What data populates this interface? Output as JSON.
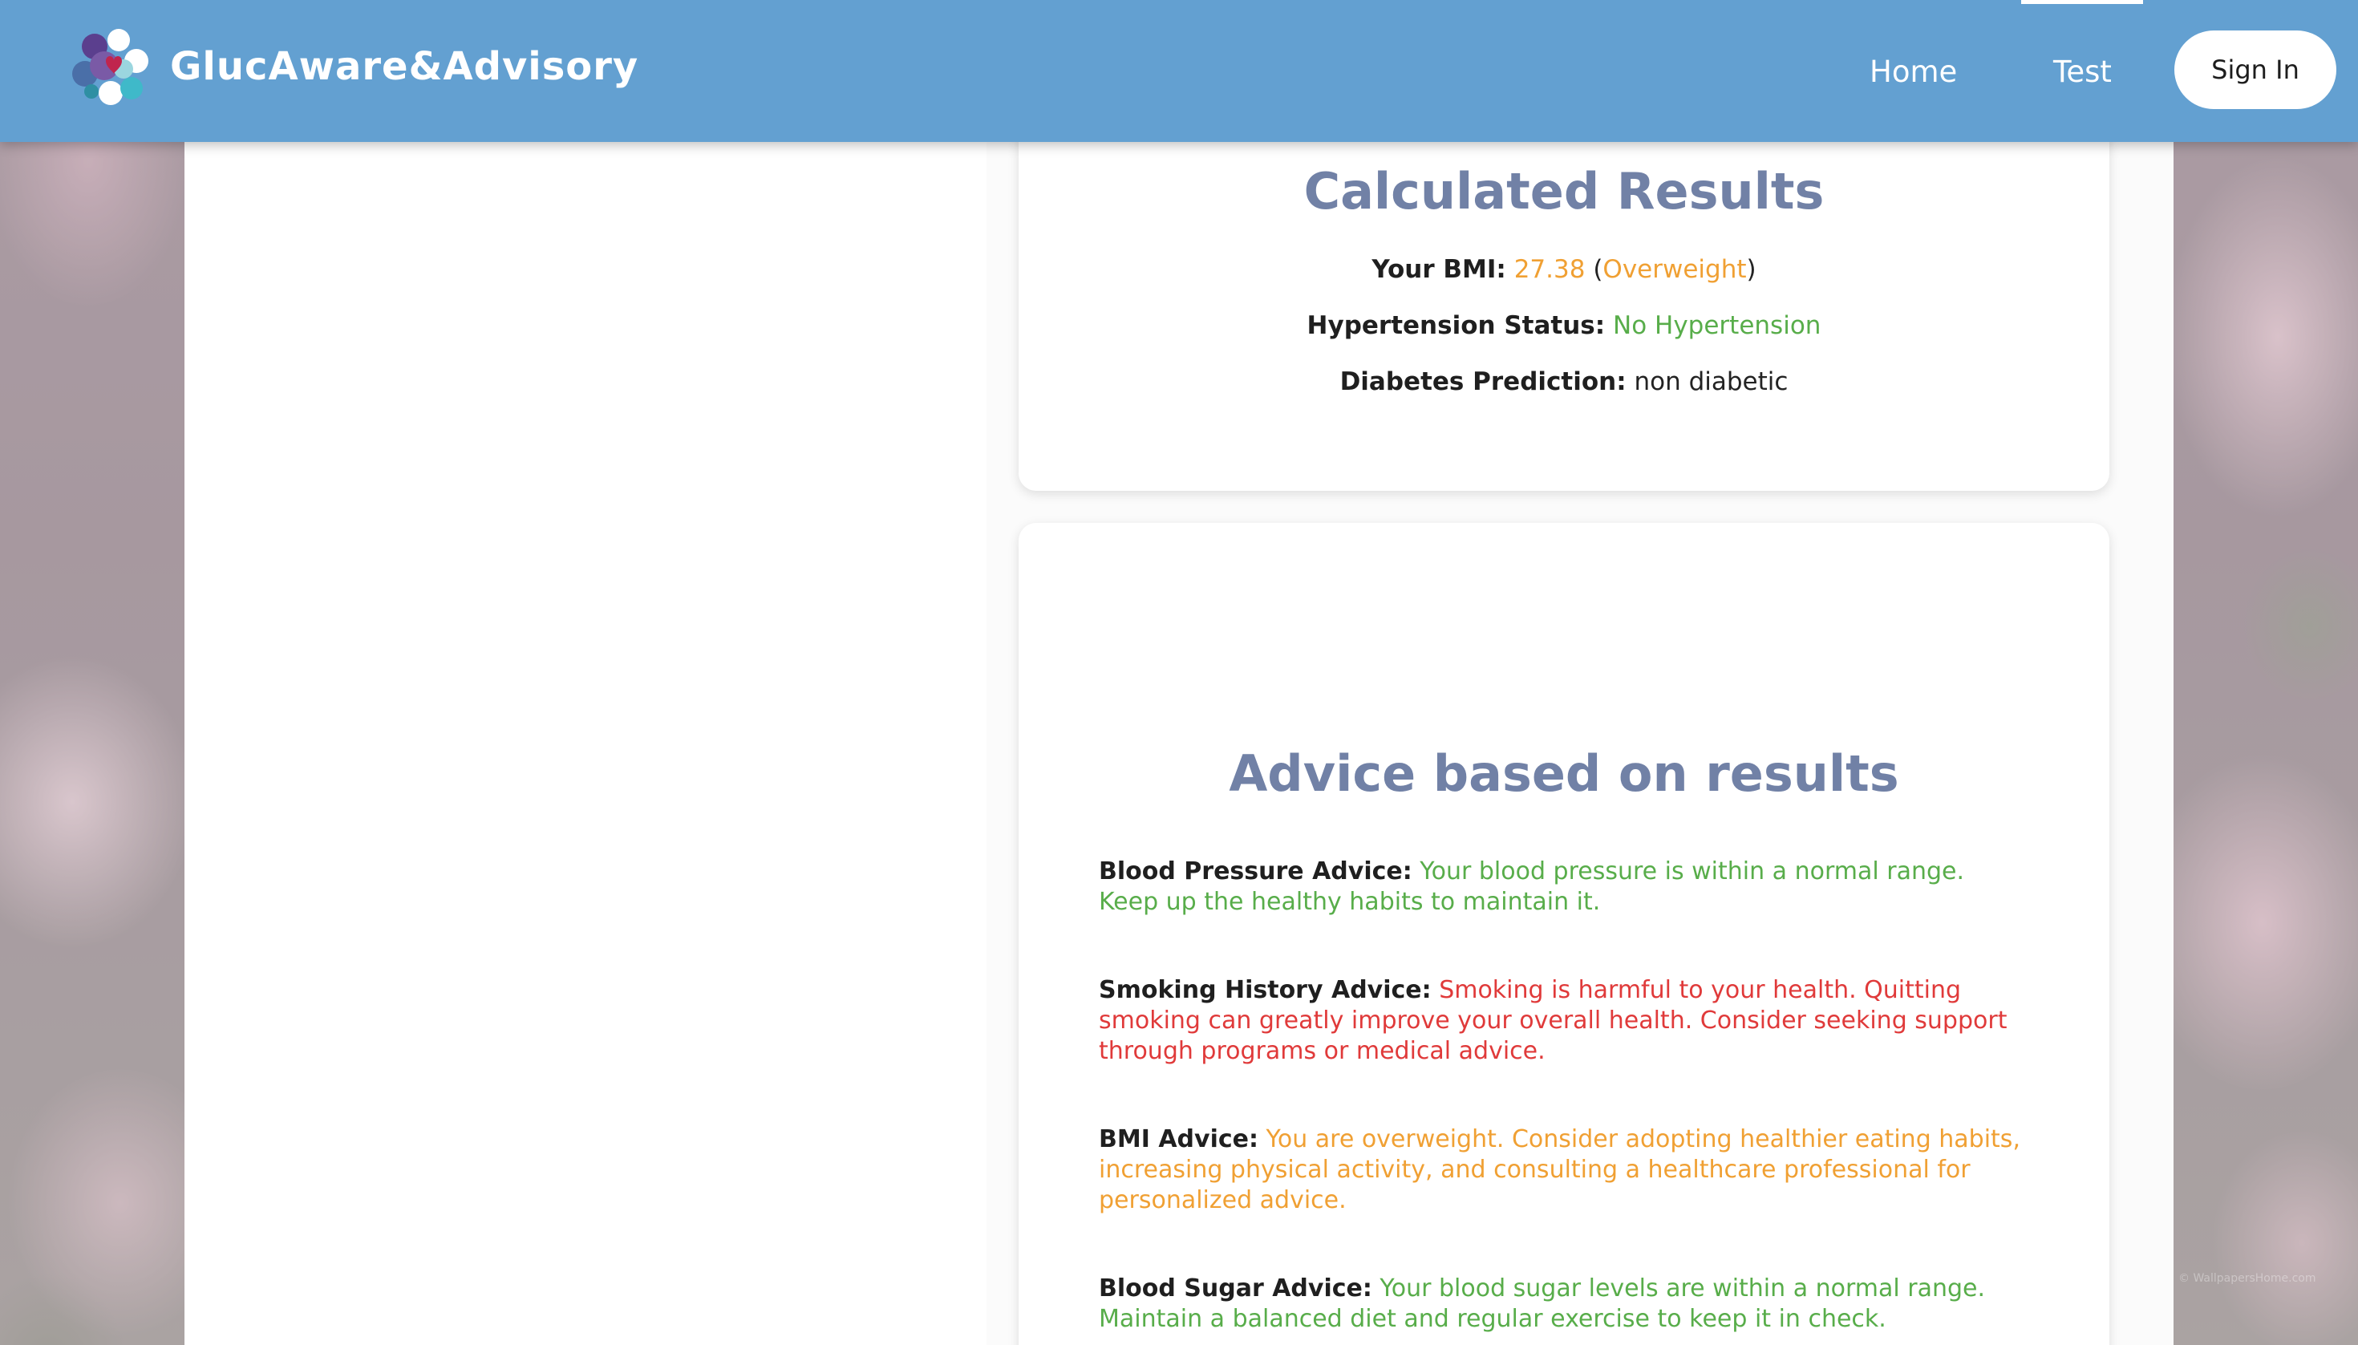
{
  "header": {
    "brand_name": "GlucAware&Advisory",
    "nav": {
      "home_label": "Home",
      "test_label": "Test",
      "signin_label": "Sign In"
    }
  },
  "results": {
    "title": "Calculated Results",
    "bmi_label": "Your BMI:",
    "bmi_value": "27.38",
    "bmi_open_paren": "(",
    "bmi_category": "Overweight",
    "bmi_close_paren": ")",
    "hypertension_label": "Hypertension Status:",
    "hypertension_value": "No Hypertension",
    "diabetes_label": "Diabetes Prediction:",
    "diabetes_value": "non diabetic"
  },
  "advice": {
    "title": "Advice based on results",
    "items": [
      {
        "label": "Blood Pressure Advice:",
        "text": "Your blood pressure is within a normal range. Keep up the healthy habits to maintain it."
      },
      {
        "label": "Smoking History Advice:",
        "text": "Smoking is harmful to your health. Quitting smoking can greatly improve your overall health. Consider seeking support through programs or medical advice."
      },
      {
        "label": "BMI Advice:",
        "text": "You are overweight. Consider adopting healthier eating habits, increasing physical activity, and consulting a healthcare professional for personalized advice."
      },
      {
        "label": "Blood Sugar Advice:",
        "text": "Your blood sugar levels are within a normal range. Maintain a balanced diet and regular exercise to keep it in check."
      }
    ]
  },
  "background": {
    "watermark": "© WallpapersHome.com"
  },
  "colors": {
    "navbar": "#63a0d1",
    "title": "#7181a6",
    "warning": "#f0a033",
    "good": "#58ad4a",
    "bad": "#e03a3a"
  }
}
